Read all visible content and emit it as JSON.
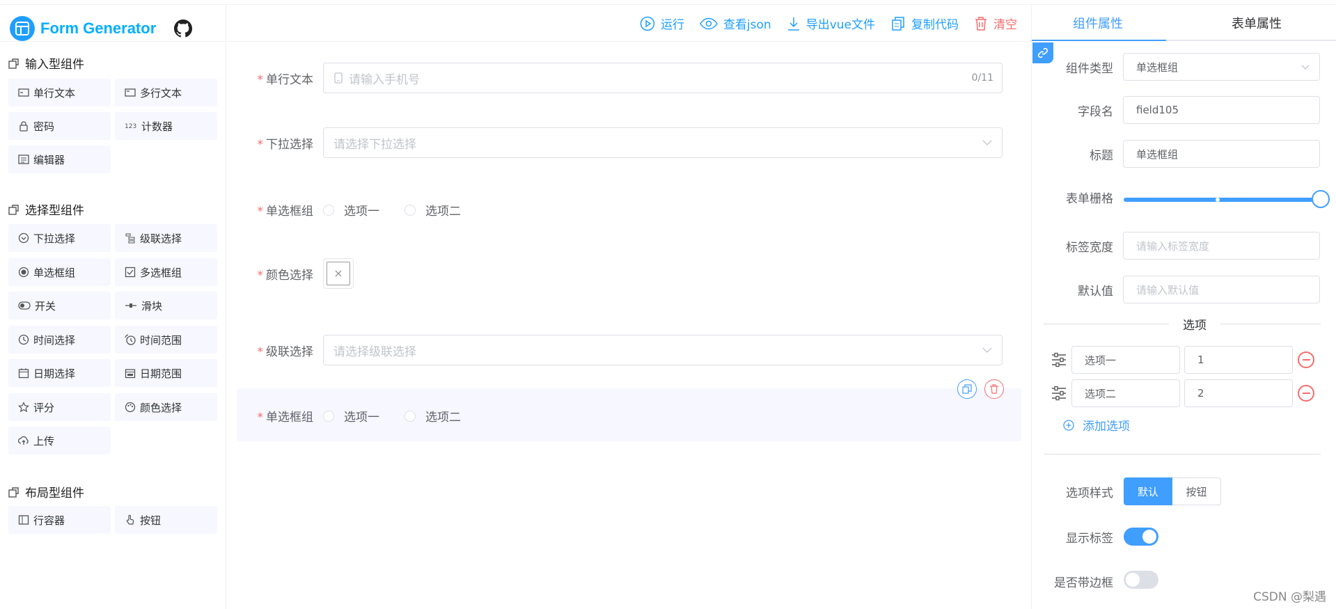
{
  "app": {
    "title": "Form Generator"
  },
  "left_panel": {
    "groups": [
      {
        "title": "输入型组件",
        "items": [
          "单行文本",
          "多行文本",
          "密码",
          "计数器",
          "编辑器"
        ]
      },
      {
        "title": "选择型组件",
        "items": [
          "下拉选择",
          "级联选择",
          "单选框组",
          "多选框组",
          "开关",
          "滑块",
          "时间选择",
          "时间范围",
          "日期选择",
          "日期范围",
          "评分",
          "颜色选择",
          "上传"
        ]
      },
      {
        "title": "布局型组件",
        "items": [
          "行容器",
          "按钮"
        ]
      }
    ]
  },
  "toolbar": {
    "run": "运行",
    "view_json": "查看json",
    "export_vue": "导出vue文件",
    "copy_code": "复制代码",
    "clear": "清空"
  },
  "canvas": {
    "star": "*",
    "text_input": {
      "label": "单行文本",
      "placeholder": "请输入手机号",
      "counter": "0/11"
    },
    "select": {
      "label": "下拉选择",
      "placeholder": "请选择下拉选择"
    },
    "radio1": {
      "label": "单选框组",
      "options": [
        "选项一",
        "选项二"
      ]
    },
    "color": {
      "label": "颜色选择"
    },
    "cascader": {
      "label": "级联选择",
      "placeholder": "请选择级联选择"
    },
    "radio2": {
      "label": "单选框组",
      "options": [
        "选项一",
        "选项二"
      ]
    }
  },
  "right_panel": {
    "tabs": [
      "组件属性",
      "表单属性"
    ],
    "component_type": {
      "label": "组件类型",
      "value": "单选框组"
    },
    "field_name": {
      "label": "字段名",
      "value": "field105"
    },
    "title": {
      "label": "标题",
      "value": "单选框组"
    },
    "grid": {
      "label": "表单栅格",
      "value": 24
    },
    "label_width": {
      "label": "标签宽度",
      "placeholder": "请输入标签宽度"
    },
    "default_value": {
      "label": "默认值",
      "placeholder": "请输入默认值"
    },
    "options_divider": "选项",
    "options": [
      {
        "label": "选项一",
        "value": "1"
      },
      {
        "label": "选项二",
        "value": "2"
      }
    ],
    "add_option": "添加选项",
    "option_style": {
      "label": "选项样式",
      "buttons": [
        "默认",
        "按钮"
      ],
      "selected": "默认"
    },
    "show_label": {
      "label": "显示标签",
      "on": true
    },
    "border": {
      "label": "是否带边框",
      "on": false
    }
  },
  "watermark": "CSDN @梨遇",
  "colors": {
    "primary": "#409eff",
    "brand": "#00afff",
    "danger": "#f56c6c",
    "component_bg": "#f6f7ff"
  }
}
